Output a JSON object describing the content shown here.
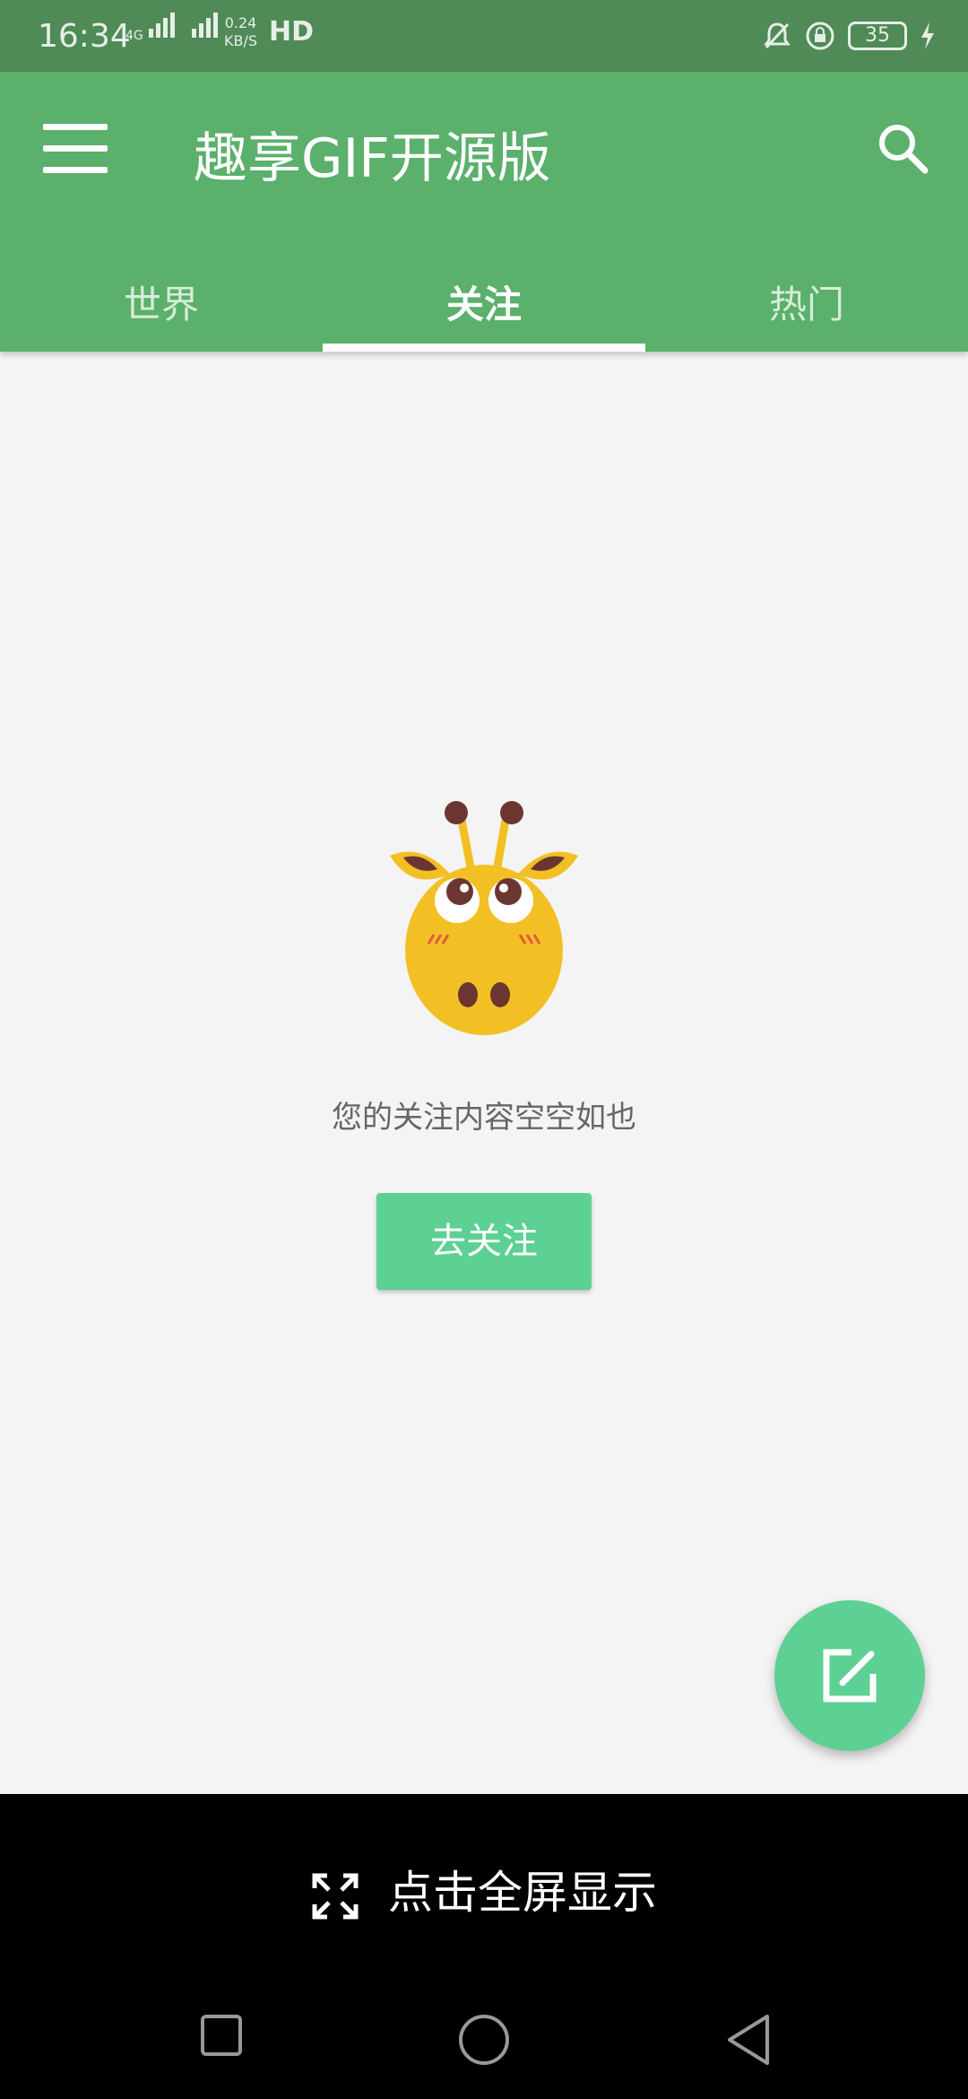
{
  "status_bar": {
    "time": "16:34",
    "network": "4G",
    "speed_value": "0.24",
    "speed_unit": "KB/S",
    "hd": "HD",
    "battery": "35"
  },
  "app_bar": {
    "title": "趣享GIF开源版",
    "menu_icon": "menu-icon",
    "search_icon": "search-icon"
  },
  "tabs": [
    {
      "label": "世界",
      "active": false
    },
    {
      "label": "关注",
      "active": true
    },
    {
      "label": "热门",
      "active": false
    }
  ],
  "empty_state": {
    "message": "您的关注内容空空如也",
    "button_label": "去关注",
    "illustration": "giraffe-mascot"
  },
  "fab": {
    "icon": "edit-icon"
  },
  "banner": {
    "label": "点击全屏显示",
    "icon": "expand-icon"
  },
  "nav_bar": {
    "icons": [
      "recents-icon",
      "home-icon",
      "back-icon"
    ]
  },
  "colors": {
    "status_bar": "#4f8a57",
    "app_bar": "#5bb06b",
    "accent": "#5dd093",
    "mascot": "#f2c024"
  }
}
